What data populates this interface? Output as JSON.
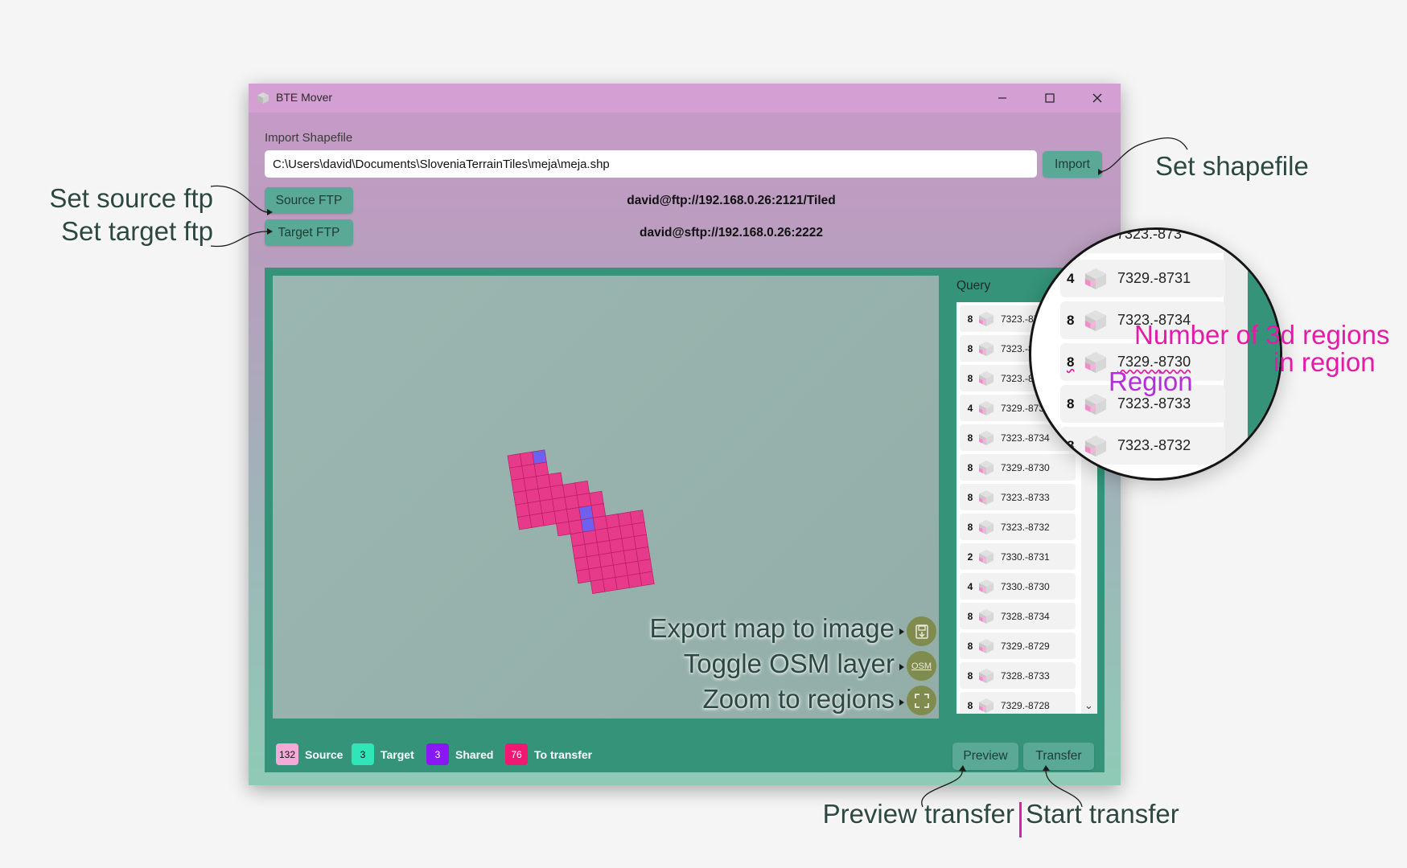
{
  "window": {
    "title": "BTE Mover",
    "app_icon": "cube-app-icon",
    "controls": [
      "minimize-icon",
      "maximize-icon",
      "close-icon"
    ]
  },
  "import": {
    "label": "Import Shapefile",
    "path_value": "C:\\Users\\david\\Documents\\SloveniaTerrainTiles\\meja\\meja.shp",
    "button": "Import"
  },
  "ftp": {
    "source_button": "Source FTP",
    "source_value": "david@ftp://192.168.0.26:2121/Tiled",
    "target_button": "Target FTP",
    "target_value": "david@sftp://192.168.0.26:2222"
  },
  "map": {
    "buttons": [
      {
        "name": "export-map-icon",
        "text": ""
      },
      {
        "name": "osm-toggle-icon",
        "text": "OSM"
      },
      {
        "name": "zoom-regions-icon",
        "text": ""
      }
    ]
  },
  "query": {
    "label": "Query",
    "items": [
      {
        "count": "8",
        "name": "7323.-87"
      },
      {
        "count": "8",
        "name": "7323.-8"
      },
      {
        "count": "8",
        "name": "7323.-8"
      },
      {
        "count": "4",
        "name": "7329.-873"
      },
      {
        "count": "8",
        "name": "7323.-8734"
      },
      {
        "count": "8",
        "name": "7329.-8730"
      },
      {
        "count": "8",
        "name": "7323.-8733"
      },
      {
        "count": "8",
        "name": "7323.-8732"
      },
      {
        "count": "2",
        "name": "7330.-8731"
      },
      {
        "count": "4",
        "name": "7330.-8730"
      },
      {
        "count": "8",
        "name": "7328.-8734"
      },
      {
        "count": "8",
        "name": "7329.-8729"
      },
      {
        "count": "8",
        "name": "7328.-8733"
      },
      {
        "count": "8",
        "name": "7329.-8728"
      }
    ],
    "scroll_icon": "chevron-down-icon"
  },
  "legend": [
    {
      "value": "132",
      "label": "Source",
      "color": "#f5a9d6"
    },
    {
      "value": "3",
      "label": "Target",
      "color": "#2ee6b8"
    },
    {
      "value": "3",
      "label": "Shared",
      "color": "#8a17f5"
    },
    {
      "value": "76",
      "label": "To transfer",
      "color": "#f01873"
    }
  ],
  "actions": {
    "preview": "Preview",
    "transfer": "Transfer"
  },
  "magnifier": {
    "top_partial": "7323.-873",
    "items": [
      {
        "count": "4",
        "name": "7329.-8731"
      },
      {
        "count": "8",
        "name": "7323.-8734"
      },
      {
        "count": "8",
        "name": "7329.-8730"
      },
      {
        "count": "8",
        "name": "7323.-8733"
      },
      {
        "count": "8",
        "name": "7323.-8732"
      }
    ]
  },
  "annotations": {
    "set_shapefile": "Set shapefile",
    "set_source_ftp": "Set source ftp",
    "set_target_ftp": "Set target ftp",
    "export_map": "Export map to image",
    "toggle_osm": "Toggle OSM layer",
    "zoom_regions": "Zoom to regions",
    "number_of_3d_line1": "Number of 3d regions",
    "number_of_3d_line2": "in region",
    "region": "Region",
    "preview_transfer": "Preview transfer",
    "start_transfer": "Start transfer"
  },
  "colors": {
    "titlebar": "#d4a0d4",
    "button": "#5aa896",
    "content_frame": "#35937a",
    "tile_source": "#e83a8a",
    "tile_shared": "#7060f0",
    "annotation_pink": "#e21ca8",
    "annotation_purple": "#b42fd8"
  }
}
